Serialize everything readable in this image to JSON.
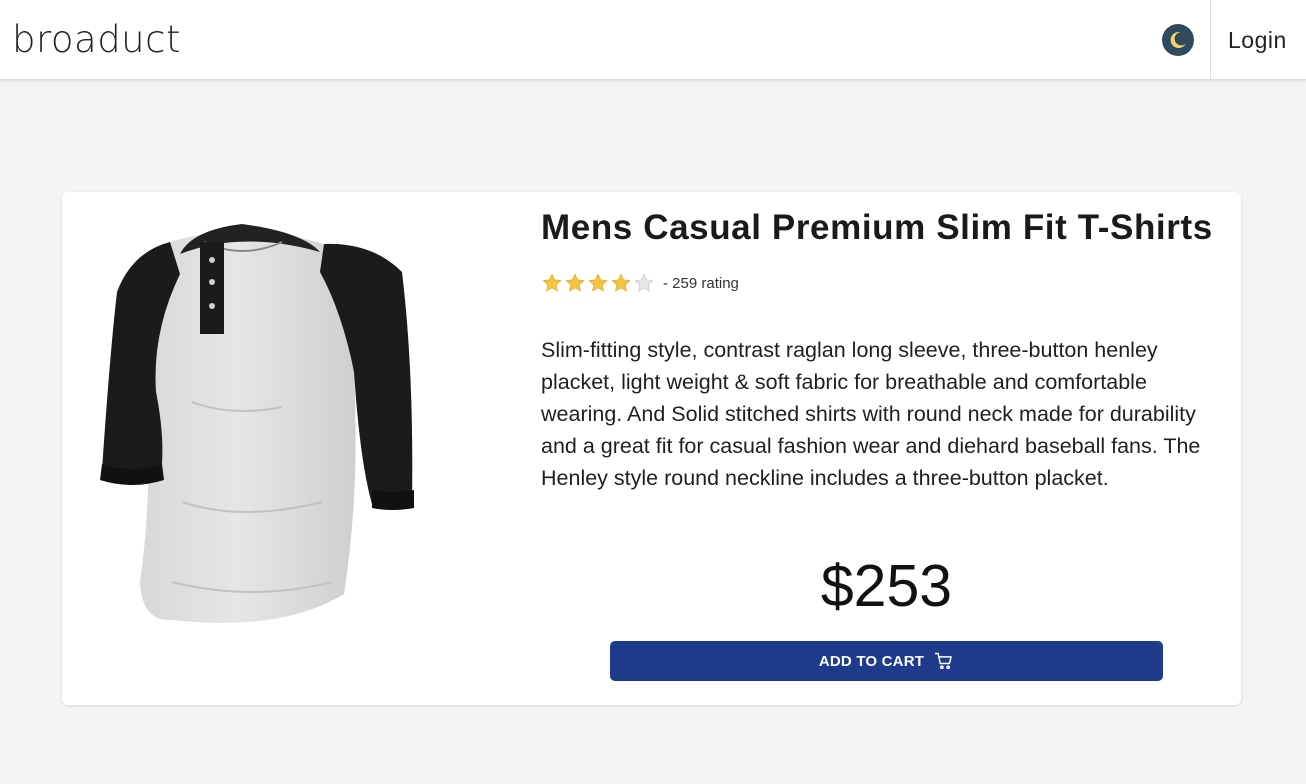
{
  "header": {
    "logo_text": "broaduct",
    "theme_toggle_icon": "moon-icon",
    "login_label": "Login"
  },
  "product": {
    "title": "Mens Casual Premium Slim Fit T-Shirts",
    "rating_value": 4,
    "rating_max": 5,
    "rating_text": "- 259 rating",
    "description": "Slim-fitting style, contrast raglan long sleeve, three-button henley placket, light weight & soft fabric for breathable and comfortable wearing. And Solid stitched shirts with round neck made for durability and a great fit for casual fashion wear and diehard baseball fans. The Henley style round neckline includes a three-button placket.",
    "price": "$253",
    "add_to_cart_label": "ADD TO CART",
    "cart_icon": "cart-icon",
    "image_alt": "raglan henley shirt"
  },
  "colors": {
    "accent": "#1e3a8a",
    "star_filled": "#f5c542",
    "star_empty": "#e6e6e6",
    "theme_toggle_bg": "#2f4a5c",
    "moon": "#f2d46b"
  }
}
